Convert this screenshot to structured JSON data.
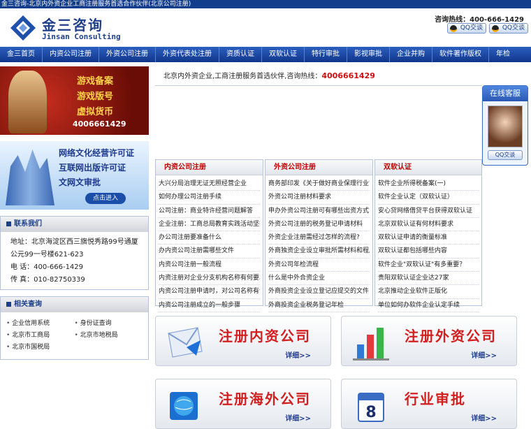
{
  "topbar": {
    "text": "金三咨询-北京内外资企业工商注册服务首选合作伙伴(北京公司注册)"
  },
  "header": {
    "logo_cn": "金三咨询",
    "logo_en": "Jinsan Consulting",
    "hotline": "咨询热线：400-666-1429",
    "qq1": "QQ交谈",
    "qq2": "QQ交谈"
  },
  "nav": [
    "金三首页",
    "内资公司注册",
    "外资公司注册",
    "外资代表处注册",
    "资质认证",
    "双软认证",
    "特行审批",
    "影视审批",
    "企业并购",
    "软件著作版权",
    "年检"
  ],
  "banner1": {
    "line1": "游戏备案",
    "line2": "游戏版号",
    "line3": "虚拟货币",
    "tel": "4006661429"
  },
  "banner2": {
    "line1": "网络文化经营许可证",
    "line2": "互联网出版许可证",
    "line3": "文网文审批",
    "go": "点击进入"
  },
  "contact": {
    "title": "联系我们",
    "address": "地址：北京海淀区西三旗悦秀路99号通厦公元99一号楼621-623",
    "phone": "电 话：400-666-1429",
    "fax": "传 真：010-82750339"
  },
  "links": {
    "title": "相关查询",
    "items": [
      "企业信用系统",
      "身份证查询",
      "北京市工商局",
      "北京市地税局",
      "北京市国税局"
    ]
  },
  "slogan": {
    "text": "北京内外资企业,工商注册服务首选伙伴,咨询热线：",
    "phone": "4006661429"
  },
  "service": {
    "title": "在线客服",
    "qq": "QQ交谈"
  },
  "columns": [
    {
      "title": "内资公司注册",
      "items": [
        "大兴分局治理无证无照经营企业",
        "如何办理公司注册手续",
        "公司注册：商业特许经营问题解答",
        "企业注册：工商总局教育实践活动坚持",
        "办公司注册要准备什么",
        "办内资公司注册需哪些文件",
        "内资公司注册一般流程",
        "内资注册对企业分支机构名称有何要求",
        "内资公司注册申请时，对公司名称有何",
        "内资公司注册成立的一般步骤"
      ]
    },
    {
      "title": "外资公司注册",
      "items": [
        "商务部印发《关于做好商业保理行业管",
        "外资公司注册材料要求",
        "申办外资公司注册可有哪些出资方式?",
        "外资公司注册的税务登记申请材料",
        "外资企业注册需经过怎样的流程?",
        "外商独资企业设立审批所需材料和程序",
        "外资公司年检流程",
        "什么是中外合资企业",
        "外商投资企业设立登记应提交的文件",
        "外商投资企业税务登记年检"
      ]
    },
    {
      "title": "双软认证",
      "items": [
        "软件企业所得税备案(一)",
        "软件企业认定（双软认证）",
        "安心贷网络借贷平台获得双软认证",
        "北京双软认证有何材料要求",
        "双软认证申请的衡量标准",
        "双软认证都包括哪些内容",
        "软件企业\"双软认证\"有多重要？",
        "贵阳双软认证企业达27家",
        "北京推动企业软件正版化",
        "单位如何办软件企业认定手续"
      ]
    }
  ],
  "cards": [
    {
      "title": "注册内资公司",
      "more": "详细>>"
    },
    {
      "title": "注册外资公司",
      "more": "详细>>"
    },
    {
      "title": "注册海外公司",
      "more": "详细>>"
    },
    {
      "title": "行业审批",
      "more": "详细>>"
    }
  ],
  "colors": {
    "nav_blue": "#1c4aa6",
    "accent_red": "#d21f1f",
    "brand_blue": "#1f3f8a"
  }
}
